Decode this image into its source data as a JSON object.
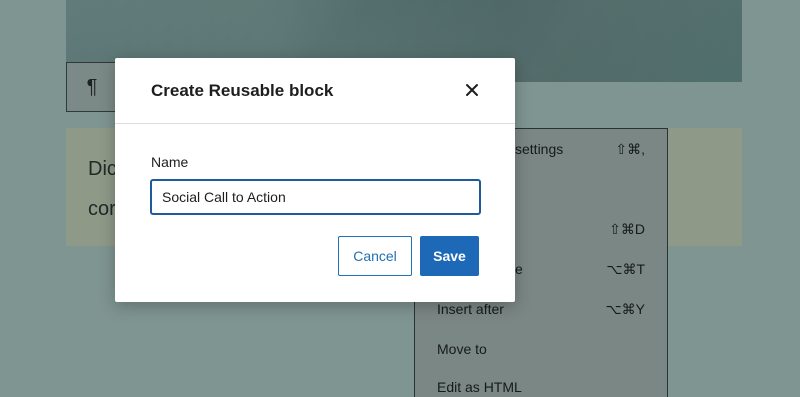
{
  "editor": {
    "paragraph_icon": "¶",
    "paragraph_line1": "Dic",
    "paragraph_line2": "cor"
  },
  "context_menu": {
    "items": [
      {
        "label": "settings",
        "shortcut": "⇧⌘,"
      },
      {
        "label": "",
        "shortcut": "⇧⌘D"
      },
      {
        "label": "e",
        "shortcut": "⌥⌘T"
      },
      {
        "label": "Insert after",
        "shortcut": "⌥⌘Y"
      },
      {
        "label": "Move to",
        "shortcut": ""
      },
      {
        "label": "Edit as HTML",
        "shortcut": ""
      }
    ]
  },
  "modal": {
    "title": "Create Reusable block",
    "close_icon": "close-icon",
    "name_label": "Name",
    "name_value": "Social Call to Action",
    "cancel_label": "Cancel",
    "save_label": "Save"
  },
  "colors": {
    "accent": "#2271b1",
    "save_bg": "#1e68b8",
    "overlay": "#7f9591"
  }
}
